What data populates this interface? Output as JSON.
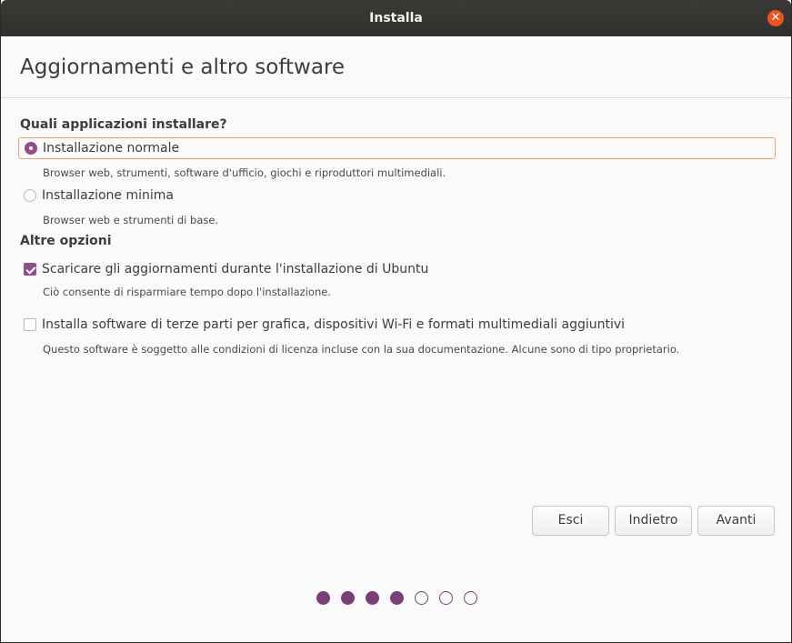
{
  "window": {
    "title": "Installa"
  },
  "page": {
    "title": "Aggiornamenti e altro software"
  },
  "apps_section": {
    "heading": "Quali applicazioni installare?",
    "options": [
      {
        "label": "Installazione normale",
        "description": "Browser web, strumenti, software d'ufficio, giochi e riproduttori multimediali.",
        "selected": true
      },
      {
        "label": "Installazione minima",
        "description": "Browser web e strumenti di base.",
        "selected": false
      }
    ]
  },
  "other_section": {
    "heading": "Altre opzioni",
    "options": [
      {
        "label": "Scaricare gli aggiornamenti durante l'installazione di Ubuntu",
        "description": "Ciò consente di risparmiare tempo dopo l'installazione.",
        "checked": true
      },
      {
        "label": "Installa software di terze parti per grafica, dispositivi Wi-Fi e formati multimediali aggiuntivi",
        "description": "Questo software è soggetto alle condizioni di licenza incluse con la sua documentazione. Alcune sono di tipo proprietario.",
        "checked": false
      }
    ]
  },
  "buttons": {
    "quit": "Esci",
    "back": "Indietro",
    "next": "Avanti"
  },
  "progress": {
    "completed_steps": 4,
    "total_steps": 7
  },
  "colors": {
    "accent": "#924d8b",
    "close_button": "#e95420",
    "focus_ring": "#e9a07f"
  }
}
